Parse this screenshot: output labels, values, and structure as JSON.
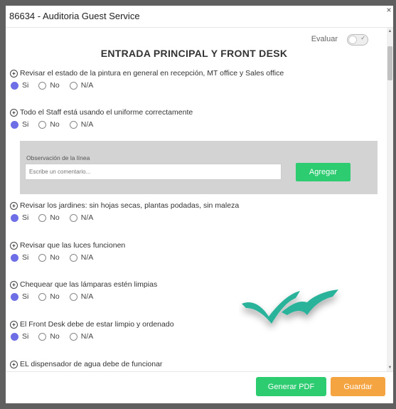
{
  "header": {
    "title": "86634 - Auditoria Guest Service",
    "close_label": "×"
  },
  "evaluar": {
    "label": "Evaluar",
    "on": false
  },
  "section": {
    "title": "ENTRADA PRINCIPAL Y FRONT DESK"
  },
  "options": {
    "si": "Si",
    "no": "No",
    "na": "N/A"
  },
  "questions": [
    {
      "text": "Revisar el estado de la pintura en general en recepción, MT office y Sales office",
      "selected": "si"
    },
    {
      "text": "Todo el Staff está usando el uniforme correctamente",
      "selected": "si"
    },
    {
      "text": "Revisar los jardines: sin hojas secas, plantas podadas, sin maleza",
      "selected": "si"
    },
    {
      "text": "Revisar que las luces funcionen",
      "selected": "si"
    },
    {
      "text": "Chequear que las lámparas estén limpias",
      "selected": "si"
    },
    {
      "text": "El Front Desk debe de estar limpio y ordenado",
      "selected": "si"
    },
    {
      "text": "EL dispensador de agua debe de funcionar",
      "selected": "si"
    }
  ],
  "observation": {
    "label": "Observación de la línea",
    "placeholder": "Escribe un comentario...",
    "add_label": "Agregar"
  },
  "footer": {
    "pdf_label": "Generar PDF",
    "save_label": "Guardar"
  },
  "colors": {
    "accent_green": "#2ecc71",
    "accent_orange": "#f5a442",
    "radio_selected": "#6e6ee6",
    "logo_teal": "#2bb39b"
  },
  "logo": {
    "icon": "wave-logo-icon"
  }
}
